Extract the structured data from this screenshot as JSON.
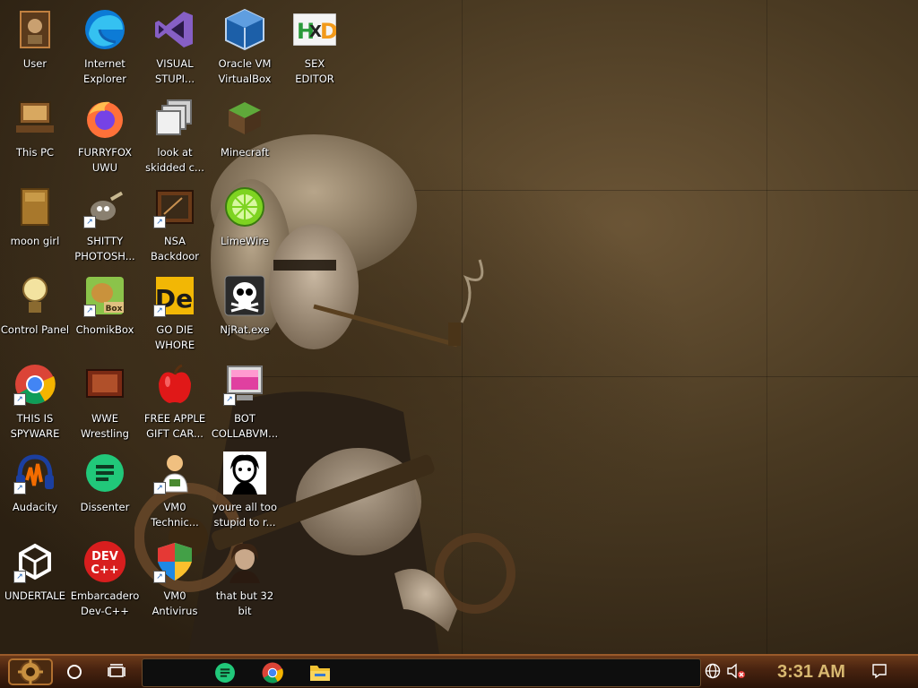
{
  "desktop": {
    "icons": [
      {
        "label": "User",
        "icon": "user-folder-icon"
      },
      {
        "label": "Internet\nExplorer",
        "icon": "edge-icon"
      },
      {
        "label": "VISUAL\nSTUPI...",
        "icon": "visual-studio-icon"
      },
      {
        "label": "Oracle VM\nVirtualBox",
        "icon": "virtualbox-icon"
      },
      {
        "label": "SEX\nEDITOR",
        "icon": "hxd-icon"
      },
      {
        "label": "This PC",
        "icon": "computer-icon"
      },
      {
        "label": "FURRYFOX\nUWU",
        "icon": "firefox-icon"
      },
      {
        "label": "look at\nskidded c...",
        "icon": "windows-stack-icon"
      },
      {
        "label": "Minecraft",
        "icon": "minecraft-icon"
      },
      {
        "label": "moon girl",
        "icon": "folder-icon"
      },
      {
        "label": "SHITTY\nPHOTOSH...",
        "icon": "gimp-icon"
      },
      {
        "label": "NSA\nBackdoor",
        "icon": "picture-icon"
      },
      {
        "label": "LimeWire",
        "icon": "limewire-icon"
      },
      {
        "label": "Control Panel",
        "icon": "lightbulb-icon"
      },
      {
        "label": "ChomikBox",
        "icon": "chomikbox-icon"
      },
      {
        "label": "GO DIE\nWHORE",
        "icon": "de-icon"
      },
      {
        "label": "NjRat.exe",
        "icon": "skull-icon"
      },
      {
        "label": "THIS IS\nSPYWARE",
        "icon": "chrome-icon"
      },
      {
        "label": "WWE\nWrestling",
        "icon": "tv-icon"
      },
      {
        "label": "FREE APPLE\nGIFT CAR...",
        "icon": "apple-icon"
      },
      {
        "label": "BOT\nCOLLABVM...",
        "icon": "monitor-icon"
      },
      {
        "label": "Audacity",
        "icon": "audacity-icon"
      },
      {
        "label": "Dissenter",
        "icon": "dissenter-icon"
      },
      {
        "label": "VM0\nTechnic...",
        "icon": "technician-icon"
      },
      {
        "label": "youre all too\nstupid to r...",
        "icon": "portrait-icon"
      },
      {
        "label": "UNDERTALE",
        "icon": "unity-icon"
      },
      {
        "label": "Embarcadero\nDev-C++",
        "icon": "devcpp-icon"
      },
      {
        "label": "VM0\nAntivirus",
        "icon": "shield-icon"
      },
      {
        "label": "that but 32\nbit",
        "icon": "portrait-icon"
      }
    ]
  },
  "taskbar": {
    "start_icon": "steampunk-gear-icon",
    "pinned": [
      {
        "name": "dissenter",
        "icon": "dissenter-icon"
      },
      {
        "name": "chrome",
        "icon": "chrome-icon"
      },
      {
        "name": "file-explorer",
        "icon": "folder-icon"
      }
    ],
    "tray": {
      "network_icon": "globe-icon",
      "volume_icon": "speaker-muted-icon",
      "clock": "3:31 AM",
      "notification_icon": "notification-icon"
    }
  },
  "colors": {
    "clock_text": "#d8b870",
    "taskbar_border": "#9a5a2a",
    "wallpaper_base": "#4a3a22"
  }
}
